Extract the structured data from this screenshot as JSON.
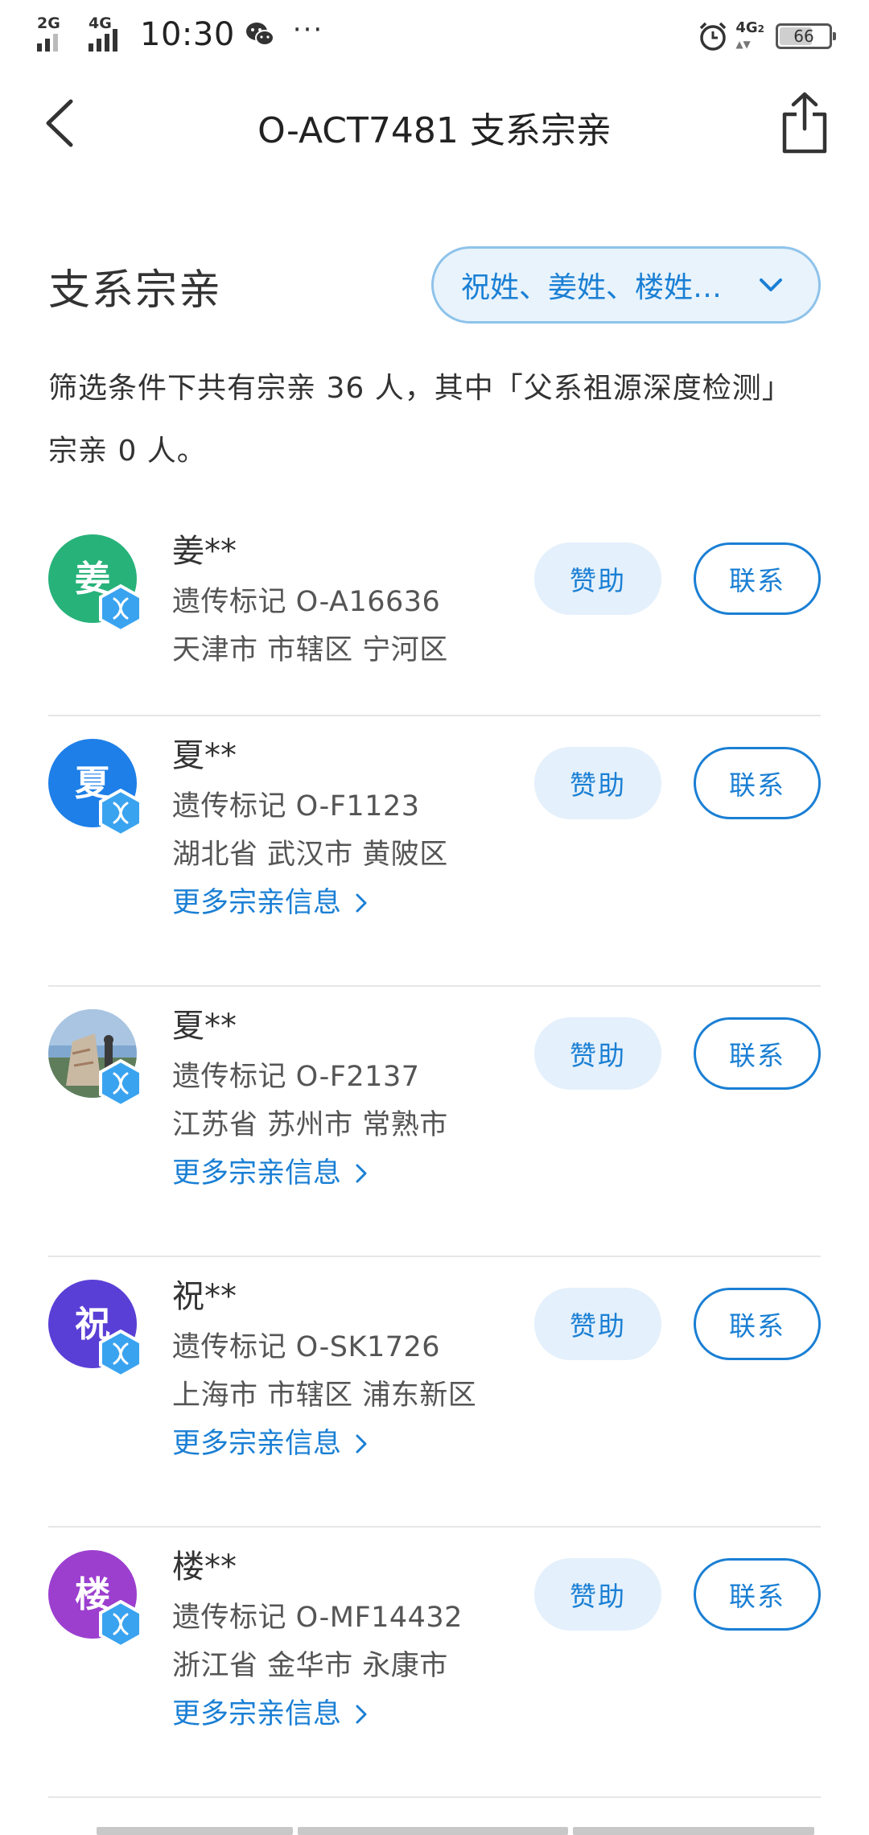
{
  "status_bar": {
    "signal_1": "2G",
    "signal_2": "4G",
    "time": "10:30",
    "more": "···",
    "network": "4G",
    "network_sub": "2",
    "battery": "66",
    "battery_level": 0.66
  },
  "nav": {
    "title": "O-ACT7481 支系宗亲"
  },
  "section": {
    "title": "支系宗亲",
    "filter_label": "祝姓、姜姓、楼姓…",
    "summary": "筛选条件下共有宗亲 36 人，其中「父系祖源深度检测」宗亲 0 人。"
  },
  "labels": {
    "sponsor": "赞助",
    "contact": "联系",
    "more_info": "更多宗亲信息"
  },
  "colors": {
    "accent": "#1a7fd4",
    "avatar_jiang": "#27b27a",
    "avatar_xia": "#1e7fe8",
    "avatar_zhu": "#5a3fd6",
    "avatar_lou": "#9c3fcf"
  },
  "relatives": [
    {
      "avatar_char": "姜",
      "name": "姜**",
      "marker": "遗传标记 O-A16636",
      "location": "天津市 市辖区 宁河区",
      "has_more": false
    },
    {
      "avatar_char": "夏",
      "name": "夏**",
      "marker": "遗传标记 O-F1123",
      "location": "湖北省 武汉市 黄陂区",
      "has_more": true
    },
    {
      "avatar_char": "",
      "name": "夏**",
      "marker": "遗传标记 O-F2137",
      "location": "江苏省 苏州市 常熟市",
      "has_more": true,
      "avatar_photo": true
    },
    {
      "avatar_char": "祝",
      "name": "祝**",
      "marker": "遗传标记 O-SK1726",
      "location": "上海市 市辖区 浦东新区",
      "has_more": true
    },
    {
      "avatar_char": "楼",
      "name": "楼**",
      "marker": "遗传标记 O-MF14432",
      "location": "浙江省 金华市 永康市",
      "has_more": true
    }
  ]
}
